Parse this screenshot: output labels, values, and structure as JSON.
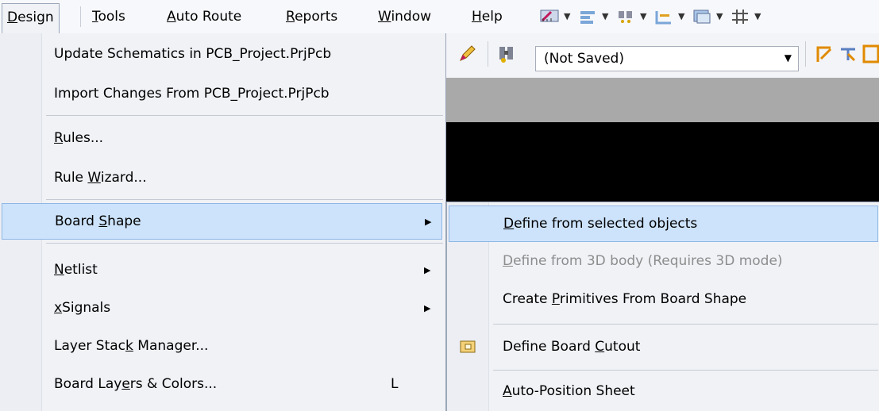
{
  "menubar": {
    "items": [
      {
        "label": "Design",
        "u": "D",
        "rest": "esign"
      },
      {
        "label": "Tools",
        "u": "T",
        "rest": "ools"
      },
      {
        "label": "Auto Route",
        "u": "A",
        "rest": "uto Route"
      },
      {
        "label": "Reports",
        "u": "R",
        "rest": "eports"
      },
      {
        "label": "Window",
        "u": "W",
        "rest": "indow"
      },
      {
        "label": "Help",
        "u": "H",
        "rest": "elp"
      }
    ]
  },
  "toolbar": {
    "document_combo": "(Not Saved)"
  },
  "design_menu": {
    "update_schematics": "Update Schematics in PCB_Project.PrjPcb",
    "import_changes": "Import Changes From PCB_Project.PrjPcb",
    "rules": {
      "u": "R",
      "rest": "ules..."
    },
    "rule_wizard": {
      "pre": "Rule ",
      "u": "W",
      "rest": "izard..."
    },
    "board_shape": {
      "pre": "Board ",
      "u": "S",
      "rest": "hape"
    },
    "netlist": {
      "u": "N",
      "rest": "etlist"
    },
    "xsignals": {
      "u": "x",
      "rest": "Signals"
    },
    "layer_stack": {
      "pre": "Layer Stac",
      "u": "k",
      "rest": " Manager..."
    },
    "board_layers": {
      "pre": "Board Lay",
      "u": "e",
      "rest": "rs & Colors..."
    },
    "board_layers_shortcut": "L"
  },
  "board_shape_submenu": {
    "define_selected": {
      "u": "D",
      "rest": "efine from selected objects"
    },
    "define_3d": {
      "u": "D",
      "rest": "efine from 3D body (Requires 3D mode)"
    },
    "create_primitives": {
      "pre": "Create ",
      "u": "P",
      "rest": "rimitives From Board Shape"
    },
    "define_cutout": {
      "pre": "Define Board ",
      "u": "C",
      "rest": "utout"
    },
    "auto_position": {
      "u": "A",
      "rest": "uto-Position Sheet"
    }
  },
  "colors": {
    "highlight": "#cde3fb",
    "highlight_border": "#8fb7e6",
    "menu_bg": "#f0f2f6",
    "disabled_text": "#8d8d8d"
  }
}
